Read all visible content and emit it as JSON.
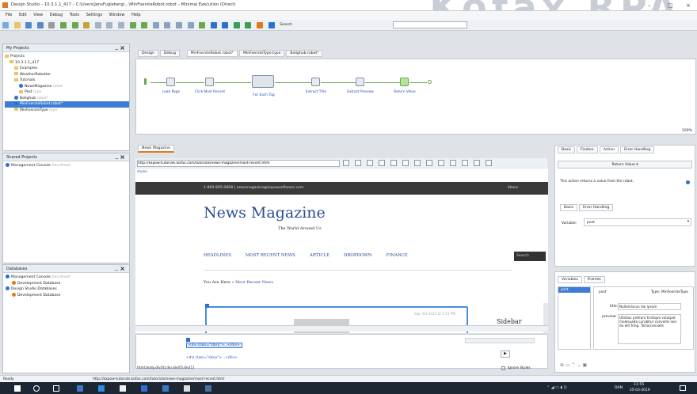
{
  "window": {
    "title": "Design Studio – 10.3.1.1_417 – C:\\Users\\JensFugleberg\\...\\MinFoersteRobot.robot – Minimal Execution (Direct)",
    "brand_watermark": "Kofax RPA"
  },
  "menu": [
    "File",
    "Edit",
    "View",
    "Debug",
    "Tools",
    "Settings",
    "Window",
    "Help"
  ],
  "toolbar": {
    "search_label": "Search",
    "search_placeholder": ""
  },
  "my_projects": {
    "title": "My Projects",
    "items": [
      {
        "label": "Projects",
        "level": 0,
        "type": "folder",
        "suffix": ""
      },
      {
        "label": "10.3.1.1_417",
        "level": 1,
        "type": "folder",
        "suffix": ""
      },
      {
        "label": "Examples",
        "level": 2,
        "type": "folder",
        "suffix": ""
      },
      {
        "label": "WeatherRobotter",
        "level": 2,
        "type": "folder",
        "suffix": ""
      },
      {
        "label": "Tutorials",
        "level": 2,
        "type": "folder",
        "suffix": ""
      },
      {
        "label": "NewsMagazine",
        "level": 3,
        "type": "robot",
        "suffix": "robot"
      },
      {
        "label": "Post",
        "level": 3,
        "type": "type",
        "suffix": "type"
      },
      {
        "label": "Bolighub",
        "level": 2,
        "type": "robot",
        "suffix": "robot*"
      },
      {
        "label": "MinFoersteRobot.robot*",
        "level": 2,
        "type": "robot",
        "suffix": "",
        "selected": true
      },
      {
        "label": "MinFoersteType",
        "level": 2,
        "type": "type",
        "suffix": "type"
      }
    ]
  },
  "shared_projects": {
    "title": "Shared Projects",
    "items": [
      {
        "label": "Management Console",
        "suffix": "(localhost)"
      }
    ]
  },
  "databases": {
    "title": "Databases",
    "items": [
      {
        "label": "Management Console",
        "suffix": "(localhost)",
        "level": 0
      },
      {
        "label": "Development Database",
        "suffix": "",
        "level": 1
      },
      {
        "label": "Design Studio Databases",
        "suffix": "",
        "level": 0
      },
      {
        "label": "Development Database",
        "suffix": "",
        "level": 1
      }
    ]
  },
  "editor_tabs": {
    "mode_tabs": [
      "Design",
      "Debug"
    ],
    "files": [
      "MinFoersteRobot.robot*",
      "MinFoersteType.type",
      "Bolighub.robot*"
    ]
  },
  "flow": {
    "steps": [
      "Load Page",
      "Click Most Recent",
      "For Each Tag",
      "Extract Title",
      "Extract Preview",
      "Return Value"
    ]
  },
  "zoom": "100%",
  "browser": {
    "tab": "News Magazine",
    "url": "http://kapow-tutorials.kofax.com/tutorials/news-magazine/most-recent.html",
    "styles_label": "styles"
  },
  "page": {
    "topbar": "1-800-805-0808 | newsmagazine@kapowsoftware.com",
    "topbar_right": "libero",
    "masthead": "News Magazine",
    "tagline": "The World Around Us",
    "nav": [
      "HEADLINES",
      "MOST RECENT NEWS",
      "ARTICLE",
      "DROPDOWN",
      "FINANCE"
    ],
    "search_stub": "Search",
    "breadcrumb_prefix": "You Are Here »",
    "breadcrumb_link": "Most Recent News",
    "sidebar": "Sidebar",
    "date": "Sep 3rd 2015 at 3:15 PM"
  },
  "dom_view": {
    "line1": "<div class=\"story\">...</div>",
    "line2": "<div class=\"story\">...</div>",
    "path": "html.body.div[4].div.div[0].div[1]",
    "ignore_styles": "Ignore Styles"
  },
  "right_panel": {
    "tabs": [
      "Basic",
      "Finders",
      "Action",
      "Error Handling"
    ],
    "action": "Return Value ▾",
    "desc": "This action returns a value from the robot.",
    "sub_tabs": [
      "Basic",
      "Error Handling"
    ],
    "variable_label": "Variable:",
    "variable_value": "post"
  },
  "variables": {
    "tabs": [
      "Variables",
      "Frames"
    ],
    "list": [
      "post"
    ],
    "type_text": "Type: MinFoersteType",
    "title_label": "title:",
    "title_value": "Nullamlacus dui ipsum",
    "preview_label": "preview:",
    "preview_value": "Ullatius pretium tristique volutpat malesuada curabitur convallis non du elit fring. Tortorconvalls"
  },
  "status": {
    "left": "Ready",
    "url": "http://kapow-tutorials.kofax.com/tutorials/news-magazine/most-recent.html"
  },
  "clock": {
    "time": "11:55",
    "date": "25-03-2019",
    "lang": "DAN"
  },
  "colors": {
    "accent": "#3d7dd8",
    "flow_green": "#6aa84f",
    "taskbar": "#1c2733"
  }
}
